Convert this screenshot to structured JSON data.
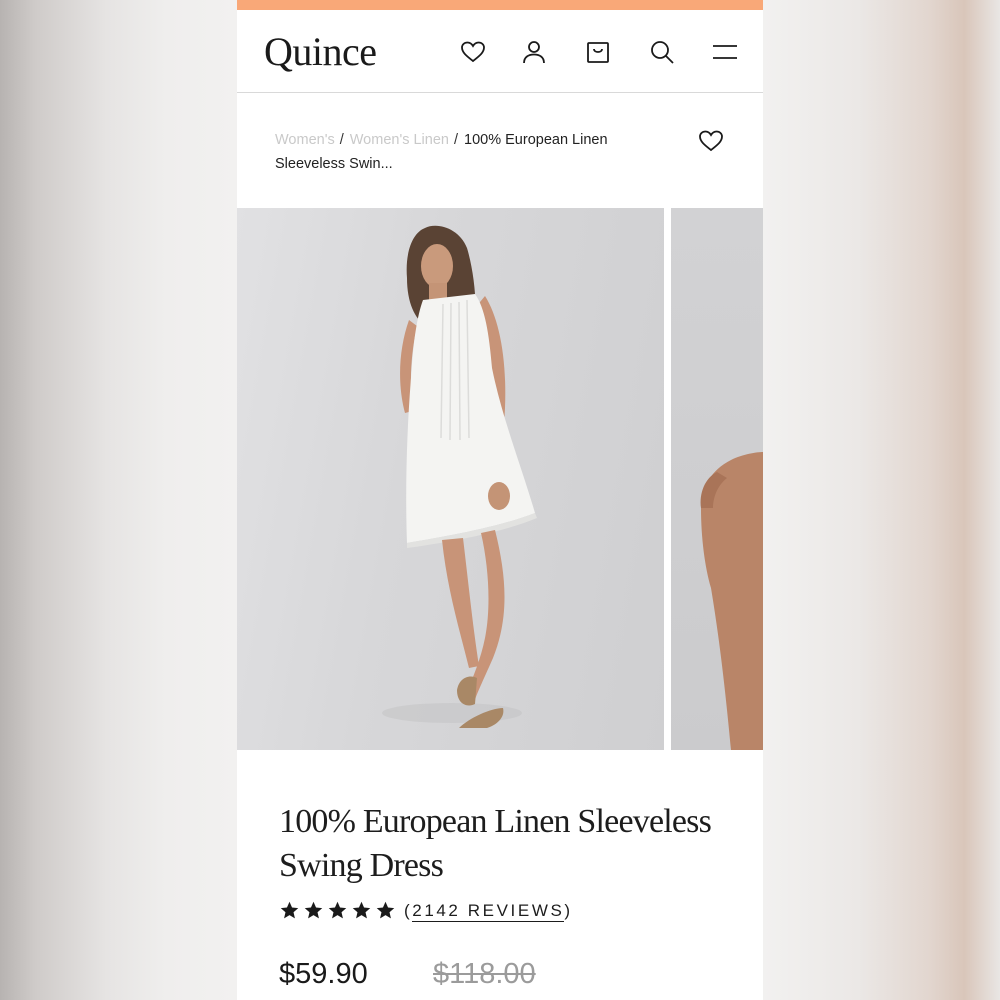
{
  "colors": {
    "accent_bar": "#f9a878",
    "text": "#1d1d1d",
    "muted_crumb": "#c9c9c9",
    "old_price": "#9b9b9b"
  },
  "header": {
    "logo": "Quince",
    "icons": [
      "heart-icon",
      "account-icon",
      "bag-icon",
      "search-icon",
      "menu-icon"
    ]
  },
  "breadcrumb": {
    "items": [
      "Women's",
      "Women's Linen",
      "100% European Linen Sleeveless Swin..."
    ],
    "separator": "/"
  },
  "gallery": {
    "images": [
      "product-photo-front",
      "product-photo-detail"
    ]
  },
  "product": {
    "title": "100% European Linen Sleeveless Swing Dress",
    "rating_stars": 5,
    "reviews_open": "(",
    "reviews_label": "2142 REVIEWS",
    "reviews_close": ")",
    "price": "$59.90",
    "original_price": "$118.00"
  }
}
